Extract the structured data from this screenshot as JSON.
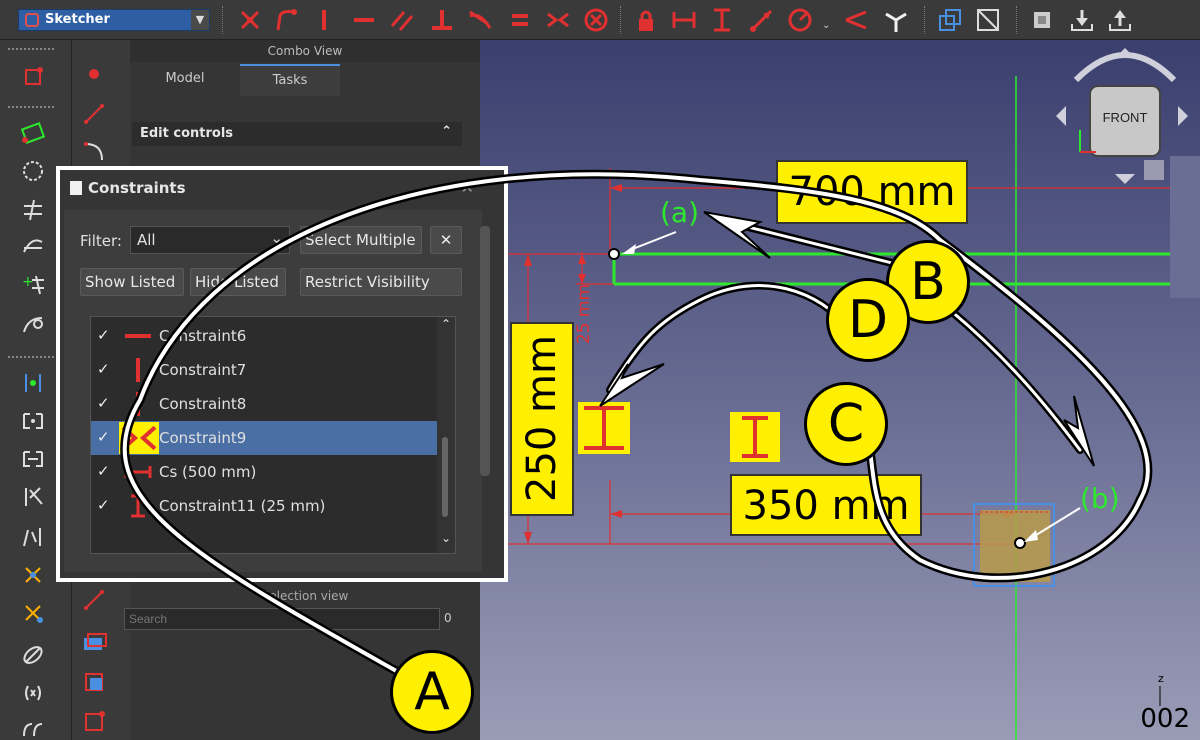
{
  "toolbar": {
    "workbench": "Sketcher",
    "colors": {
      "accent": "#2e5ea3",
      "constraint_red": "#e03030",
      "highlight_yellow": "#ffef00",
      "sketch_green": "#2ee82e"
    }
  },
  "combo_view": {
    "title": "Combo View",
    "tabs": [
      "Model",
      "Tasks"
    ],
    "active_tab": "Tasks",
    "edit_controls": "Edit controls",
    "selection_view_title": "Selection view",
    "search_placeholder": "Search",
    "selection_count": "0"
  },
  "constraints": {
    "title": "Constraints",
    "filter_label": "Filter:",
    "filter_value": "All",
    "select_multiple": "Select Multiple",
    "show_listed": "Show Listed",
    "hide_listed": "Hide Listed",
    "restrict_visibility": "Restrict Visibility",
    "items": [
      {
        "label": "Constraint6",
        "icon": "horizontal-constraint-icon",
        "checked": true
      },
      {
        "label": "Constraint7",
        "icon": "vertical-constraint-icon",
        "checked": true
      },
      {
        "label": "Constraint8",
        "icon": "vertical-constraint-icon",
        "checked": true
      },
      {
        "label": "Constraint9",
        "icon": "symmetric-constraint-icon",
        "checked": true,
        "selected": true
      },
      {
        "label": "Cs (500 mm)",
        "icon": "horizontal-distance-icon",
        "checked": true
      },
      {
        "label": "Constraint11 (25 mm)",
        "icon": "vertical-distance-icon",
        "checked": true
      }
    ]
  },
  "viewport": {
    "dim_700": "700 mm",
    "dim_350": "350 mm",
    "dim_250": "250 mm",
    "dim_25": "25 mm",
    "label_a": "(a)",
    "label_b": "(b)",
    "navcube_face": "FRONT",
    "axis_z": "z",
    "page_number": "002"
  },
  "callouts": {
    "A": "A",
    "B": "B",
    "C": "C",
    "D": "D"
  }
}
